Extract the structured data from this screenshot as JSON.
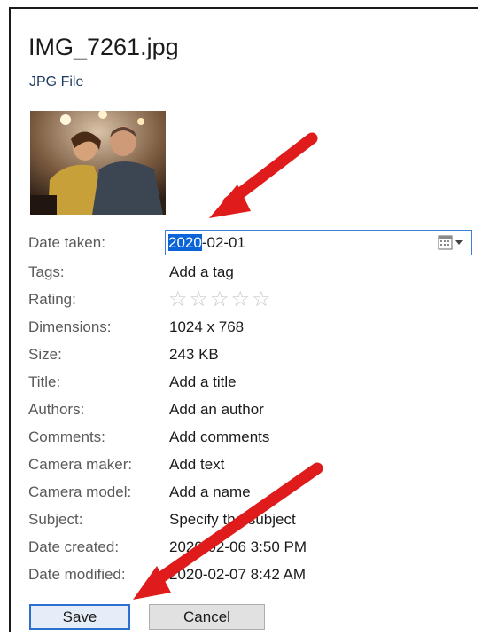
{
  "file": {
    "name": "IMG_7261.jpg",
    "type": "JPG File"
  },
  "properties": [
    {
      "label": "Date taken:",
      "value": ""
    },
    {
      "label": "Tags:",
      "value": "Add a tag"
    },
    {
      "label": "Rating:",
      "value": ""
    },
    {
      "label": "Dimensions:",
      "value": "1024 x 768"
    },
    {
      "label": "Size:",
      "value": "243 KB"
    },
    {
      "label": "Title:",
      "value": "Add a title"
    },
    {
      "label": "Authors:",
      "value": "Add an author"
    },
    {
      "label": "Comments:",
      "value": "Add comments"
    },
    {
      "label": "Camera maker:",
      "value": "Add text"
    },
    {
      "label": "Camera model:",
      "value": "Add a name"
    },
    {
      "label": "Subject:",
      "value": "Specify the subject"
    },
    {
      "label": "Date created:",
      "value": "2020-02-06 3:50 PM"
    },
    {
      "label": "Date modified:",
      "value": "2020-02-07 8:42 AM"
    }
  ],
  "date_taken": {
    "selected": "2020",
    "rest": "-02-01"
  },
  "rating": {
    "stars_filled": 0,
    "stars_total": 5,
    "glyphs": "☆☆☆☆☆"
  },
  "buttons": {
    "save": "Save",
    "cancel": "Cancel"
  },
  "colors": {
    "arrow": "#e01b1b",
    "focus": "#3c7fd6",
    "selection": "#0a64d8"
  }
}
